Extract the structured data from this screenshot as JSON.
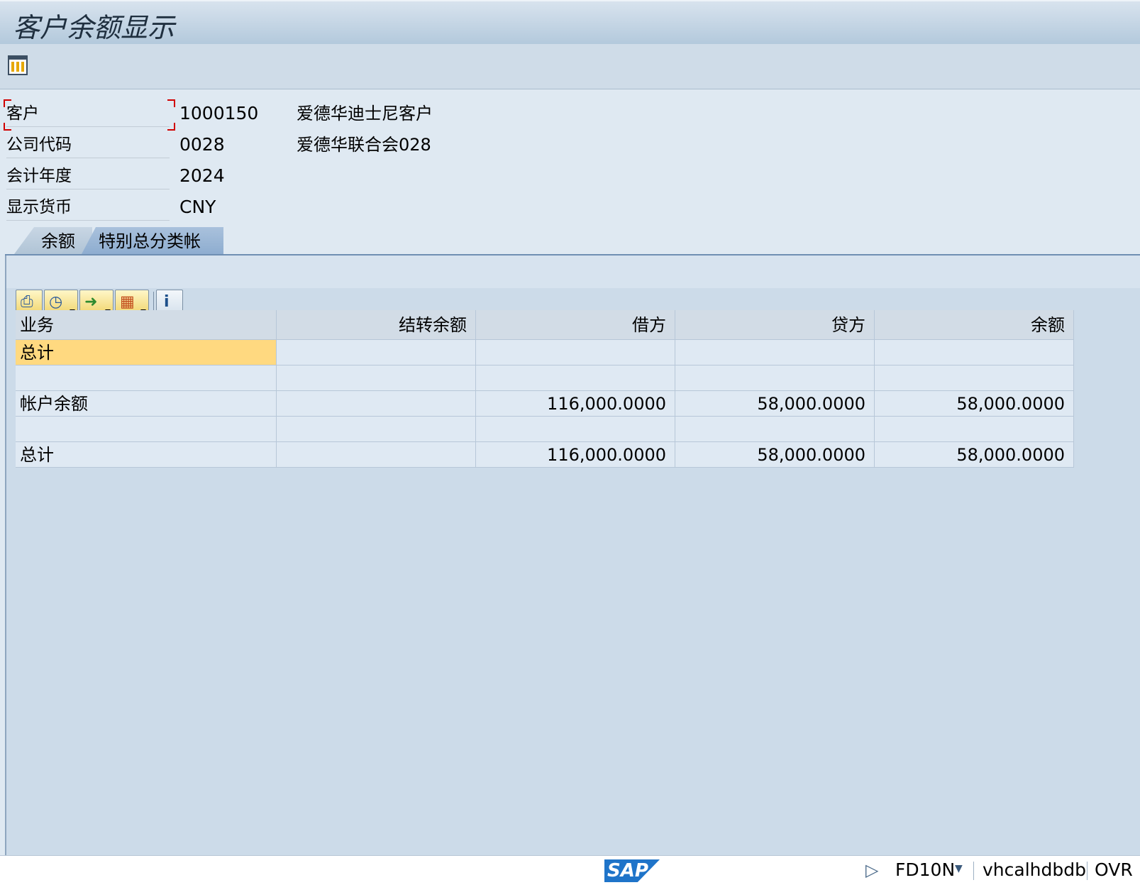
{
  "window": {
    "title": "客户余额显示"
  },
  "toolbar": {
    "layout_icon": "layout-icon"
  },
  "fields": [
    {
      "label": "客户",
      "value": "1000150",
      "desc": "爱德华迪士尼客户"
    },
    {
      "label": "公司代码",
      "value": "0028",
      "desc": "爱德华联合会028"
    },
    {
      "label": "会计年度",
      "value": "2024",
      "desc": ""
    },
    {
      "label": "显示货币",
      "value": "CNY",
      "desc": ""
    }
  ],
  "tabs": [
    {
      "label": "余额",
      "active": false
    },
    {
      "label": "特别总分类帐",
      "active": true
    }
  ],
  "grid_toolbar": {
    "buttons": [
      "print-icon",
      "view-icon",
      "export-icon",
      "layout-select-icon",
      "info-icon"
    ]
  },
  "grid": {
    "columns": [
      "业务",
      "结转余额",
      "借方",
      "贷方",
      "余额"
    ],
    "rows": [
      [
        "总计",
        "",
        "",
        "",
        ""
      ],
      [
        "",
        "",
        "",
        "",
        ""
      ],
      [
        "帐户余额",
        "",
        "116,000.0000",
        "58,000.0000",
        "58,000.0000"
      ],
      [
        "",
        "",
        "",
        "",
        ""
      ],
      [
        "总计",
        "",
        "116,000.0000",
        "58,000.0000",
        "58,000.0000"
      ]
    ]
  },
  "statusbar": {
    "logo": "SAP",
    "transaction": "FD10N",
    "host": "vhcalhdbdb",
    "mode": "OVR"
  }
}
